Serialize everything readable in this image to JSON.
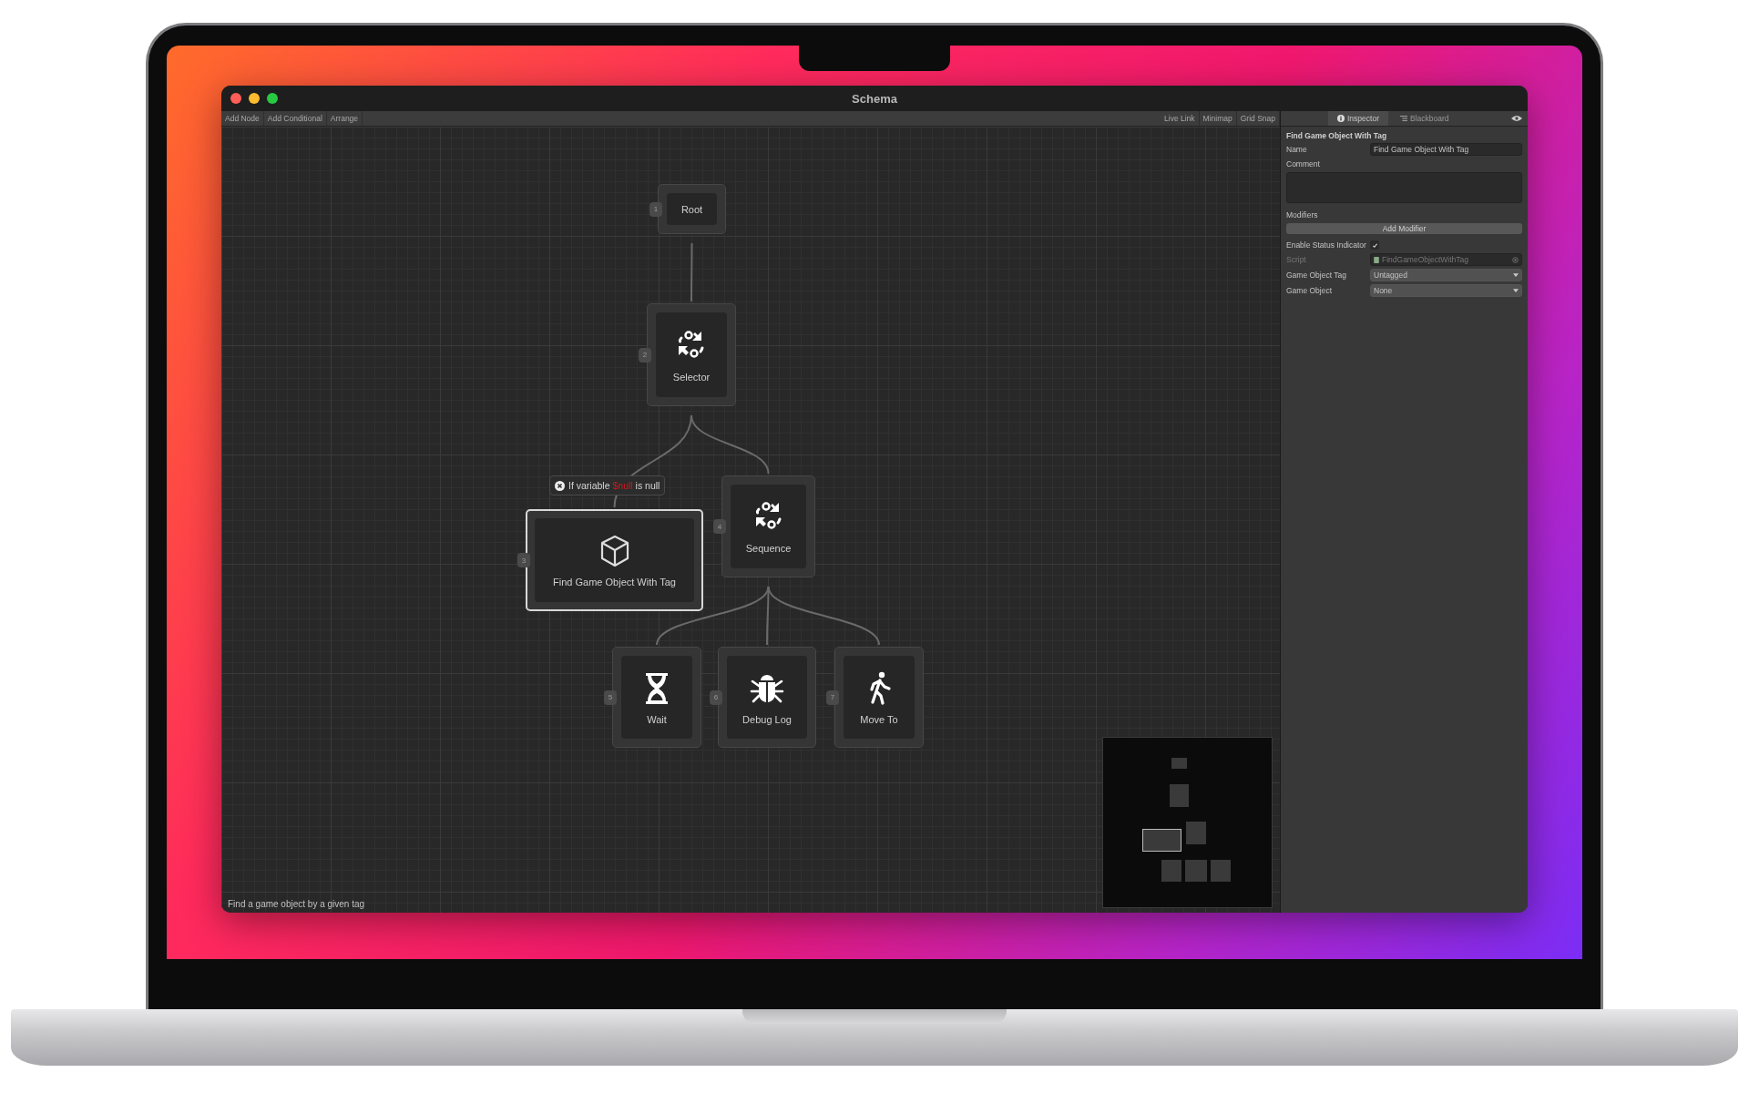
{
  "window": {
    "title": "Schema"
  },
  "toolbar": {
    "left": [
      "Add Node",
      "Add Conditional",
      "Arrange"
    ],
    "right": [
      "Live Link",
      "Minimap",
      "Grid Snap"
    ]
  },
  "inspector_tabs": [
    {
      "label": "Inspector",
      "kind": "info",
      "selected": true
    },
    {
      "label": "Blackboard",
      "kind": "list",
      "selected": false
    }
  ],
  "nodes": [
    {
      "index": "1",
      "label": "Root",
      "kind": "root",
      "selected": false
    },
    {
      "index": "2",
      "label": "Selector",
      "kind": "cycle",
      "selected": false
    },
    {
      "index": "3",
      "label": "Find Game Object With Tag",
      "kind": "cube",
      "selected": true
    },
    {
      "index": "4",
      "label": "Sequence",
      "kind": "cycle",
      "selected": false
    },
    {
      "index": "5",
      "label": "Wait",
      "kind": "hourglass",
      "selected": false
    },
    {
      "index": "6",
      "label": "Debug Log",
      "kind": "bug",
      "selected": false
    },
    {
      "index": "7",
      "label": "Move To",
      "kind": "walk",
      "selected": false
    }
  ],
  "conditional": {
    "text_before": "If variable",
    "variable": "$null",
    "text_after": "is null"
  },
  "inspector": {
    "heading": "Find Game Object With Tag",
    "fields": [
      {
        "kind": "text",
        "label": "Name",
        "value": "Find Game Object With Tag"
      },
      {
        "kind": "area",
        "label": "Comment"
      },
      {
        "kind": "section",
        "label": "Modifiers"
      },
      {
        "kind": "button",
        "label": "Add Modifier"
      },
      {
        "kind": "check",
        "label": "Enable Status Indicator",
        "checked": true
      },
      {
        "kind": "object",
        "label": "Script",
        "value": "FindGameObjectWithTag",
        "disabled": true
      },
      {
        "kind": "dropdown",
        "label": "Game Object Tag",
        "value": "Untagged"
      },
      {
        "kind": "dropdown",
        "label": "Game Object",
        "value": "None"
      }
    ]
  },
  "status_bar": "Find a game object by a given tag"
}
